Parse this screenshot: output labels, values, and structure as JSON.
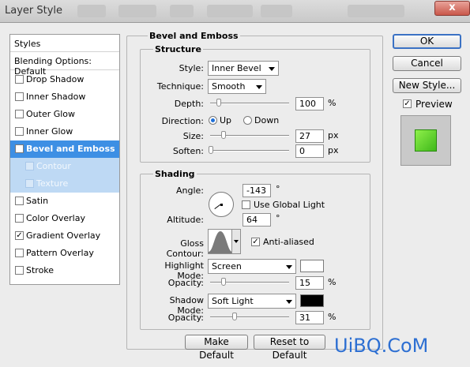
{
  "window": {
    "title": "Layer Style",
    "close_label": "x"
  },
  "left_panel": {
    "header": "Styles",
    "blending": "Blending Options: Default",
    "items": [
      {
        "label": "Drop Shadow",
        "checked": false
      },
      {
        "label": "Inner Shadow",
        "checked": false
      },
      {
        "label": "Outer Glow",
        "checked": false
      },
      {
        "label": "Inner Glow",
        "checked": false
      },
      {
        "label": "Bevel and Emboss",
        "checked": true
      },
      {
        "label": "Contour",
        "checked": false
      },
      {
        "label": "Texture",
        "checked": false
      },
      {
        "label": "Satin",
        "checked": false
      },
      {
        "label": "Color Overlay",
        "checked": false
      },
      {
        "label": "Gradient Overlay",
        "checked": true
      },
      {
        "label": "Pattern Overlay",
        "checked": false
      },
      {
        "label": "Stroke",
        "checked": false
      }
    ]
  },
  "bevel": {
    "title": "Bevel and Emboss",
    "structure": {
      "title": "Structure",
      "style_label": "Style:",
      "style_value": "Inner Bevel",
      "technique_label": "Technique:",
      "technique_value": "Smooth",
      "depth_label": "Depth:",
      "depth_value": "100",
      "depth_unit": "%",
      "direction_label": "Direction:",
      "dir_up": "Up",
      "dir_down": "Down",
      "direction_selected": "Up",
      "size_label": "Size:",
      "size_value": "27",
      "size_unit": "px",
      "soften_label": "Soften:",
      "soften_value": "0",
      "soften_unit": "px"
    },
    "shading": {
      "title": "Shading",
      "angle_label": "Angle:",
      "angle_value": "-143",
      "angle_unit": "°",
      "global_light_label": "Use Global Light",
      "global_light_checked": false,
      "altitude_label": "Altitude:",
      "altitude_value": "64",
      "altitude_unit": "°",
      "gloss_label": "Gloss Contour:",
      "antialiased_label": "Anti-aliased",
      "antialiased_checked": true,
      "highlight_mode_label": "Highlight Mode:",
      "highlight_mode_value": "Screen",
      "highlight_color": "#ffffff",
      "h_opacity_label": "Opacity:",
      "h_opacity_value": "15",
      "h_opacity_unit": "%",
      "shadow_mode_label": "Shadow Mode:",
      "shadow_mode_value": "Soft Light",
      "shadow_color": "#000000",
      "s_opacity_label": "Opacity:",
      "s_opacity_value": "31",
      "s_opacity_unit": "%"
    },
    "make_default": "Make Default",
    "reset_default": "Reset to Default"
  },
  "buttons": {
    "ok": "OK",
    "cancel": "Cancel",
    "new_style": "New Style...",
    "preview_label": "Preview",
    "preview_checked": true
  },
  "preview_color": "#55d81d",
  "watermark": "UiBQ.CoM"
}
